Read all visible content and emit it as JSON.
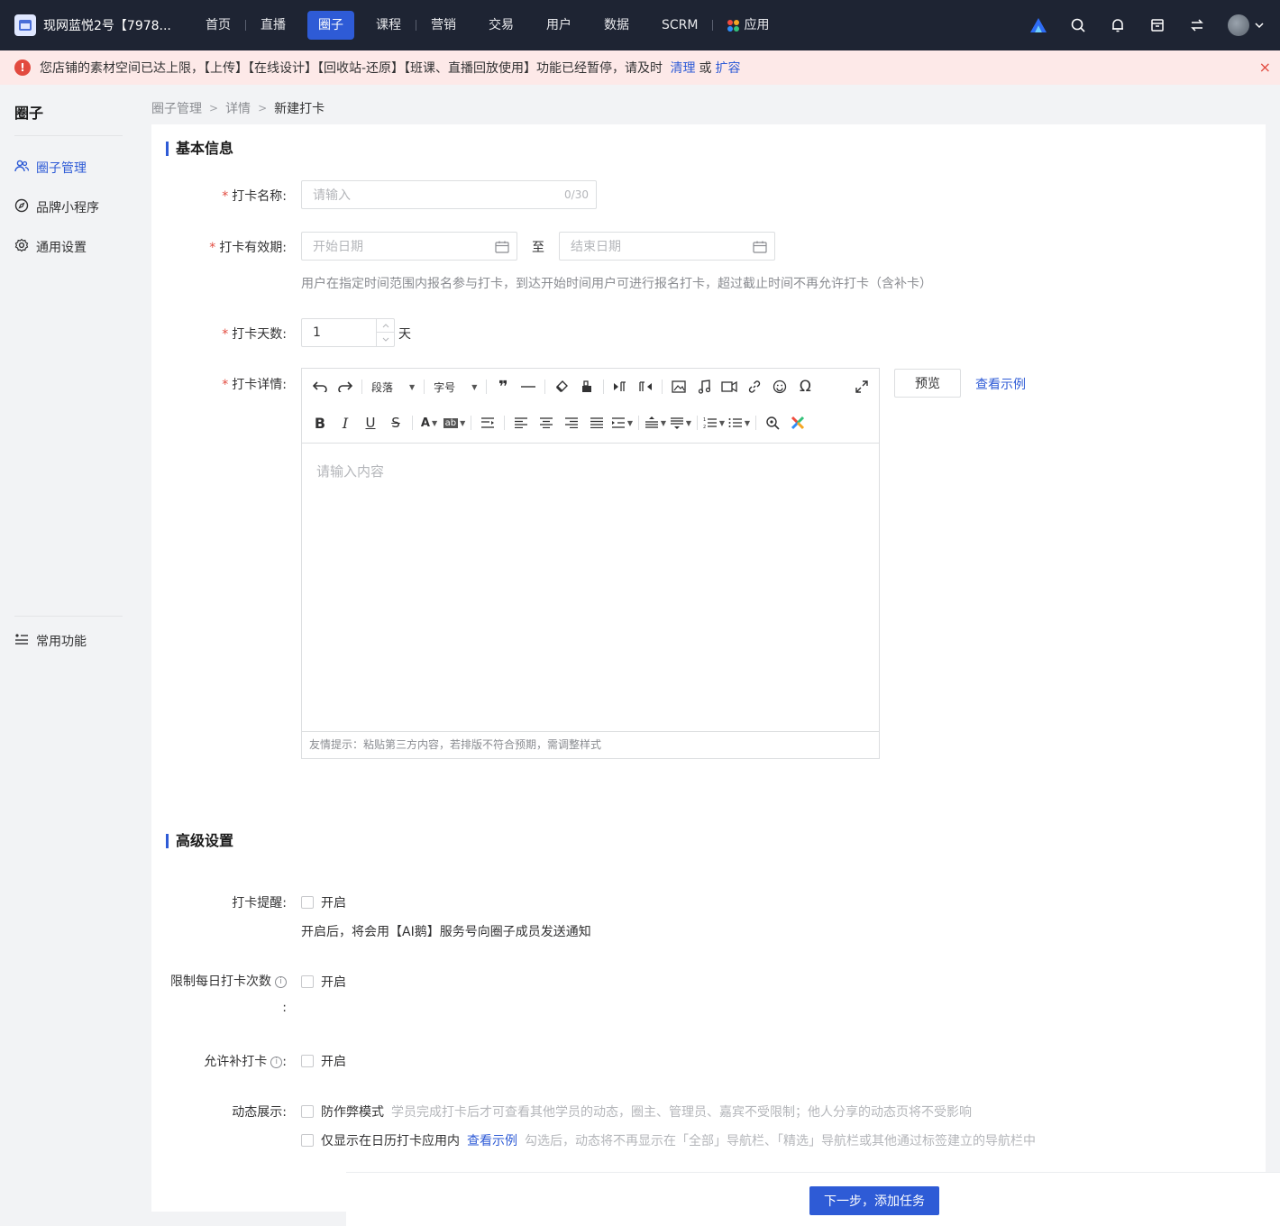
{
  "topbar": {
    "shop_name": "现网蓝悦2号【7978...",
    "nav": [
      "首页",
      "直播",
      "圈子",
      "课程",
      "营销",
      "交易",
      "用户",
      "数据",
      "SCRM",
      "应用"
    ],
    "active_nav": "圈子"
  },
  "banner": {
    "text": "您店铺的素材空间已达上限，【上传】【在线设计】【回收站-还原】【班课、直播回放使用】功能已经暂停，请及时",
    "link_clean": "清理",
    "or": "或",
    "link_expand": "扩容",
    "close": "×"
  },
  "sidebar": {
    "title": "圈子",
    "items": [
      "圈子管理",
      "品牌小程序",
      "通用设置"
    ],
    "bottom_item": "常用功能"
  },
  "breadcrumb": [
    "圈子管理",
    "详情",
    "新建打卡"
  ],
  "basic": {
    "title": "基本信息",
    "name_label": "打卡名称:",
    "name_placeholder": "请输入",
    "name_count": "0/30",
    "period_label": "打卡有效期:",
    "start_placeholder": "开始日期",
    "to": "至",
    "end_placeholder": "结束日期",
    "period_hint": "用户在指定时间范围内报名参与打卡，到达开始时间用户可进行报名打卡，超过截止时间不再允许打卡（含补卡）",
    "days_label": "打卡天数:",
    "days_value": "1",
    "days_unit": "天",
    "detail_label": "打卡详情:",
    "paragraph": "段落",
    "font_size": "字号",
    "editor_placeholder": "请输入内容",
    "editor_tip": "友情提示：粘贴第三方内容，若排版不符合预期，需调整样式",
    "preview": "预览",
    "view_example": "查看示例"
  },
  "advanced": {
    "title": "高级设置",
    "remind_label": "打卡提醒:",
    "enable": "开启",
    "remind_hint": "开启后，将会用【AI鹅】服务号向圈子成员发送通知",
    "limit_label": "限制每日打卡次数",
    "colon": ":",
    "makeup_label": "允许补打卡",
    "display_label": "动态展示:",
    "anti_cheat": "防作弊模式",
    "anti_cheat_hint": "学员完成打卡后才可查看其他学员的动态，圈主、管理员、嘉宾不受限制；他人分享的动态页将不受影响",
    "calendar_only": "仅显示在日历打卡应用内",
    "view_example": "查看示例",
    "calendar_hint": "勾选后，动态将不再显示在「全部」导航栏、「精选」导航栏或其他通过标签建立的导航栏中"
  },
  "footer": {
    "next": "下一步，添加任务"
  },
  "colors": {
    "accent": "#2e5bd6",
    "topbar": "#1e2433",
    "danger": "#e24a3f"
  }
}
